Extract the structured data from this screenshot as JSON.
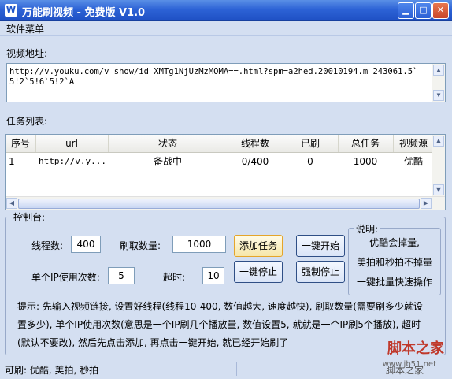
{
  "window": {
    "title": "万能刷视频 - 免费版 V1.0",
    "icon_letter": "W"
  },
  "menu": {
    "label": "软件菜单"
  },
  "url_section": {
    "label": "视频地址:",
    "value": "http://v.youku.com/v_show/id_XMTg1NjUzMzMOMA==.html?spm=a2hed.20010194.m_243061.5`5!2`5!6`5!2`A"
  },
  "task_section": {
    "label": "任务列表:",
    "columns": [
      "序号",
      "url",
      "状态",
      "线程数",
      "已刷",
      "总任务",
      "视频源"
    ],
    "rows": [
      [
        "1",
        "http://v.y...",
        "备战中",
        "0/400",
        "0",
        "1000",
        "优酷"
      ]
    ]
  },
  "control": {
    "legend": "控制台:",
    "threads_label": "线程数:",
    "threads_value": "400",
    "count_label": "刷取数量:",
    "count_value": "1000",
    "ip_label": "单个IP使用次数:",
    "ip_value": "5",
    "timeout_label": "超时:",
    "timeout_value": "10",
    "buttons": {
      "add_task": "添加任务",
      "start_all": "一键开始",
      "stop_all": "一键停止",
      "force_stop": "强制停止"
    },
    "note": {
      "title": "说明:",
      "lines": [
        "优酷会掉量,",
        "美拍和秒拍不掉量",
        "一键批量快速操作"
      ]
    },
    "hint": "提示: 先输入视频链接, 设置好线程(线程10-400, 数值越大, 速度越快), 刷取数量(需要刷多少就设置多少), 单个IP使用次数(意思是一个IP刷几个播放量, 数值设置5, 就就是一个IP刷5个播放), 超时(默认不要改), 然后先点击添加, 再点击一键开始, 就已经开始刷了"
  },
  "status": {
    "left": "可刷: 优酷, 美拍, 秒拍",
    "right": "脚本之家"
  },
  "watermark": {
    "text": "脚本之家",
    "url": "www.jb51.net"
  }
}
